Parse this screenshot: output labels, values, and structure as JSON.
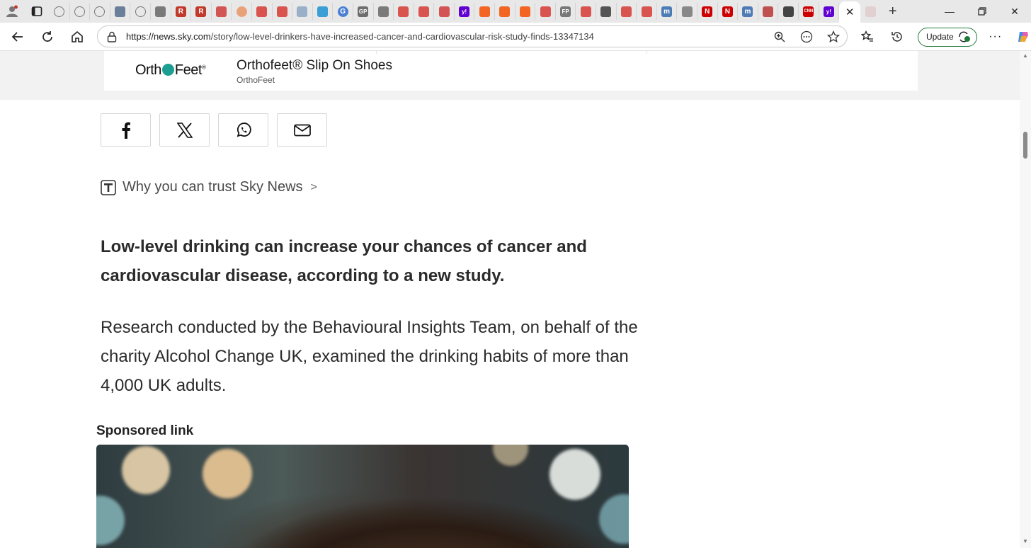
{
  "browser": {
    "url_host": "https://news.sky.com",
    "url_path": "/story/low-level-drinkers-have-increased-cancer-and-cardiovascular-risk-study-finds-13347134",
    "update_label": "Update",
    "pinned_tabs": [
      {
        "kind": "globe",
        "color": "#777777",
        "letter": ""
      },
      {
        "kind": "globe",
        "color": "#777777",
        "letter": ""
      },
      {
        "kind": "globe",
        "color": "#777777",
        "letter": ""
      },
      {
        "kind": "square",
        "color": "#6b7f9a",
        "letter": ""
      },
      {
        "kind": "globe",
        "color": "#777777",
        "letter": ""
      },
      {
        "kind": "square",
        "color": "#7a7a7a",
        "letter": ""
      },
      {
        "kind": "square",
        "color": "#c0392b",
        "letter": "R"
      },
      {
        "kind": "square",
        "color": "#c0392b",
        "letter": "R"
      },
      {
        "kind": "square",
        "color": "#d35454",
        "letter": ""
      },
      {
        "kind": "round",
        "color": "#e8a27a",
        "letter": ""
      },
      {
        "kind": "square",
        "color": "#d9534f",
        "letter": ""
      },
      {
        "kind": "square",
        "color": "#d9534f",
        "letter": ""
      },
      {
        "kind": "square",
        "color": "#9ab0c8",
        "letter": ""
      },
      {
        "kind": "square",
        "color": "#3b9fd6",
        "letter": ""
      },
      {
        "kind": "round",
        "color": "#4a7fd4",
        "letter": "G"
      },
      {
        "kind": "square",
        "color": "#6d6d6d",
        "letter": "GP"
      },
      {
        "kind": "square",
        "color": "#7a7a7a",
        "letter": ""
      },
      {
        "kind": "square",
        "color": "#d9534f",
        "letter": ""
      },
      {
        "kind": "square",
        "color": "#d9534f",
        "letter": ""
      },
      {
        "kind": "square",
        "color": "#d35454",
        "letter": ""
      },
      {
        "kind": "square",
        "color": "#6001d2",
        "letter": "y!"
      },
      {
        "kind": "square",
        "color": "#f26522",
        "letter": ""
      },
      {
        "kind": "square",
        "color": "#f26522",
        "letter": ""
      },
      {
        "kind": "square",
        "color": "#f26522",
        "letter": ""
      },
      {
        "kind": "square",
        "color": "#d9534f",
        "letter": ""
      },
      {
        "kind": "square",
        "color": "#777777",
        "letter": "FP"
      },
      {
        "kind": "square",
        "color": "#d9534f",
        "letter": ""
      },
      {
        "kind": "square",
        "color": "#555555",
        "letter": ""
      },
      {
        "kind": "square",
        "color": "#d9534f",
        "letter": ""
      },
      {
        "kind": "square",
        "color": "#d9534f",
        "letter": ""
      },
      {
        "kind": "square",
        "color": "#4d7bb5",
        "letter": "m"
      },
      {
        "kind": "square",
        "color": "#888888",
        "letter": ""
      },
      {
        "kind": "square",
        "color": "#cc0000",
        "letter": "N"
      },
      {
        "kind": "square",
        "color": "#cc0000",
        "letter": "N"
      },
      {
        "kind": "square",
        "color": "#4d7bb5",
        "letter": "m"
      },
      {
        "kind": "square",
        "color": "#c05050",
        "letter": ""
      },
      {
        "kind": "square",
        "color": "#444444",
        "letter": ""
      },
      {
        "kind": "square",
        "color": "#cc0000",
        "letter": "CNN"
      },
      {
        "kind": "square",
        "color": "#6001d2",
        "letter": "y!"
      }
    ]
  },
  "ad": {
    "logo_left": "Orth",
    "logo_right": "Feet",
    "title": "Orthofeet® Slip On Shoes",
    "advertiser": "OrthoFeet"
  },
  "share": {
    "icons": [
      "facebook-icon",
      "x-icon",
      "whatsapp-icon",
      "email-icon"
    ]
  },
  "trust": {
    "label": "Why you can trust Sky News"
  },
  "article": {
    "lead": "Low-level drinking can increase your chances of cancer and cardiovascular disease, according to a new study.",
    "paragraph": "Research conducted by the Behavioural Insights Team, on behalf of the charity Alcohol Change UK, examined the drinking habits of more than 4,000 UK adults."
  },
  "sponsored": {
    "label": "Sponsored link"
  },
  "colors": {
    "update_border": "#1f7a3a",
    "text_dark": "#2b2b2b"
  }
}
